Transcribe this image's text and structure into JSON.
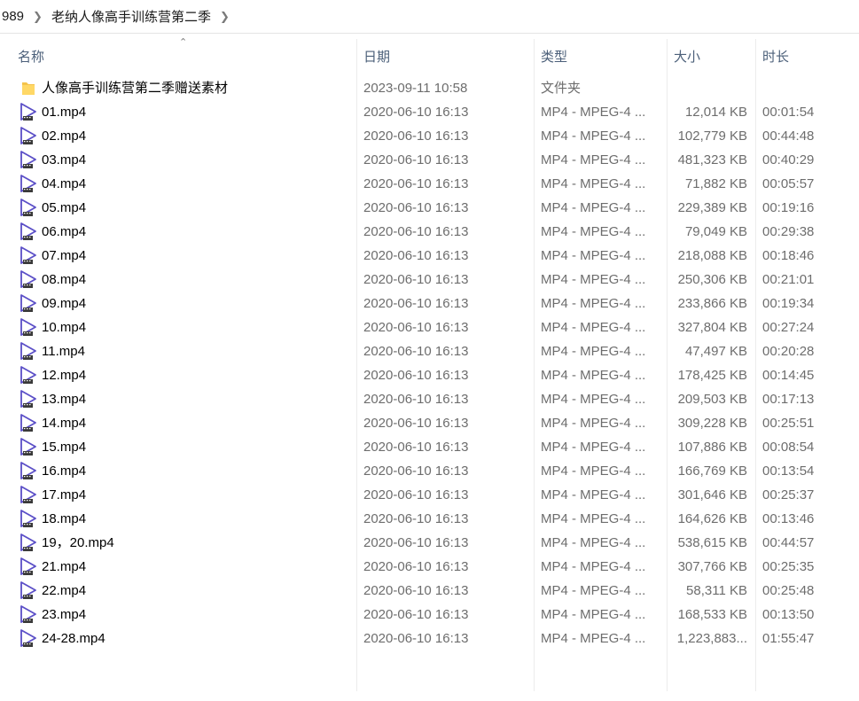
{
  "breadcrumb": {
    "items": [
      "989",
      "老纳人像高手训练营第二季"
    ]
  },
  "columns": {
    "name": "名称",
    "date": "日期",
    "type": "类型",
    "size": "大小",
    "duration": "时长"
  },
  "colors": {
    "video_icon": "#5b4fc7",
    "folder_icon": "#f5c34a",
    "header_text": "#4c607a"
  },
  "rows": [
    {
      "name": "人像高手训练营第二季赠送素材",
      "date": "2023-09-11 10:58",
      "type": "文件夹",
      "size": "",
      "duration": "",
      "icon": "folder-icon"
    },
    {
      "name": "01.mp4",
      "date": "2020-06-10 16:13",
      "type": "MP4 - MPEG-4 ...",
      "size": "12,014 KB",
      "duration": "00:01:54",
      "icon": "video-file-icon"
    },
    {
      "name": "02.mp4",
      "date": "2020-06-10 16:13",
      "type": "MP4 - MPEG-4 ...",
      "size": "102,779 KB",
      "duration": "00:44:48",
      "icon": "video-file-icon"
    },
    {
      "name": "03.mp4",
      "date": "2020-06-10 16:13",
      "type": "MP4 - MPEG-4 ...",
      "size": "481,323 KB",
      "duration": "00:40:29",
      "icon": "video-file-icon"
    },
    {
      "name": "04.mp4",
      "date": "2020-06-10 16:13",
      "type": "MP4 - MPEG-4 ...",
      "size": "71,882 KB",
      "duration": "00:05:57",
      "icon": "video-file-icon"
    },
    {
      "name": "05.mp4",
      "date": "2020-06-10 16:13",
      "type": "MP4 - MPEG-4 ...",
      "size": "229,389 KB",
      "duration": "00:19:16",
      "icon": "video-file-icon"
    },
    {
      "name": "06.mp4",
      "date": "2020-06-10 16:13",
      "type": "MP4 - MPEG-4 ...",
      "size": "79,049 KB",
      "duration": "00:29:38",
      "icon": "video-file-icon"
    },
    {
      "name": "07.mp4",
      "date": "2020-06-10 16:13",
      "type": "MP4 - MPEG-4 ...",
      "size": "218,088 KB",
      "duration": "00:18:46",
      "icon": "video-file-icon"
    },
    {
      "name": "08.mp4",
      "date": "2020-06-10 16:13",
      "type": "MP4 - MPEG-4 ...",
      "size": "250,306 KB",
      "duration": "00:21:01",
      "icon": "video-file-icon"
    },
    {
      "name": "09.mp4",
      "date": "2020-06-10 16:13",
      "type": "MP4 - MPEG-4 ...",
      "size": "233,866 KB",
      "duration": "00:19:34",
      "icon": "video-file-icon"
    },
    {
      "name": "10.mp4",
      "date": "2020-06-10 16:13",
      "type": "MP4 - MPEG-4 ...",
      "size": "327,804 KB",
      "duration": "00:27:24",
      "icon": "video-file-icon"
    },
    {
      "name": "11.mp4",
      "date": "2020-06-10 16:13",
      "type": "MP4 - MPEG-4 ...",
      "size": "47,497 KB",
      "duration": "00:20:28",
      "icon": "video-file-icon"
    },
    {
      "name": "12.mp4",
      "date": "2020-06-10 16:13",
      "type": "MP4 - MPEG-4 ...",
      "size": "178,425 KB",
      "duration": "00:14:45",
      "icon": "video-file-icon"
    },
    {
      "name": "13.mp4",
      "date": "2020-06-10 16:13",
      "type": "MP4 - MPEG-4 ...",
      "size": "209,503 KB",
      "duration": "00:17:13",
      "icon": "video-file-icon"
    },
    {
      "name": "14.mp4",
      "date": "2020-06-10 16:13",
      "type": "MP4 - MPEG-4 ...",
      "size": "309,228 KB",
      "duration": "00:25:51",
      "icon": "video-file-icon"
    },
    {
      "name": "15.mp4",
      "date": "2020-06-10 16:13",
      "type": "MP4 - MPEG-4 ...",
      "size": "107,886 KB",
      "duration": "00:08:54",
      "icon": "video-file-icon"
    },
    {
      "name": "16.mp4",
      "date": "2020-06-10 16:13",
      "type": "MP4 - MPEG-4 ...",
      "size": "166,769 KB",
      "duration": "00:13:54",
      "icon": "video-file-icon"
    },
    {
      "name": "17.mp4",
      "date": "2020-06-10 16:13",
      "type": "MP4 - MPEG-4 ...",
      "size": "301,646 KB",
      "duration": "00:25:37",
      "icon": "video-file-icon"
    },
    {
      "name": "18.mp4",
      "date": "2020-06-10 16:13",
      "type": "MP4 - MPEG-4 ...",
      "size": "164,626 KB",
      "duration": "00:13:46",
      "icon": "video-file-icon"
    },
    {
      "name": "19，20.mp4",
      "date": "2020-06-10 16:13",
      "type": "MP4 - MPEG-4 ...",
      "size": "538,615 KB",
      "duration": "00:44:57",
      "icon": "video-file-icon"
    },
    {
      "name": "21.mp4",
      "date": "2020-06-10 16:13",
      "type": "MP4 - MPEG-4 ...",
      "size": "307,766 KB",
      "duration": "00:25:35",
      "icon": "video-file-icon"
    },
    {
      "name": "22.mp4",
      "date": "2020-06-10 16:13",
      "type": "MP4 - MPEG-4 ...",
      "size": "58,311 KB",
      "duration": "00:25:48",
      "icon": "video-file-icon"
    },
    {
      "name": "23.mp4",
      "date": "2020-06-10 16:13",
      "type": "MP4 - MPEG-4 ...",
      "size": "168,533 KB",
      "duration": "00:13:50",
      "icon": "video-file-icon"
    },
    {
      "name": "24-28.mp4",
      "date": "2020-06-10 16:13",
      "type": "MP4 - MPEG-4 ...",
      "size": "1,223,883...",
      "duration": "01:55:47",
      "icon": "video-file-icon"
    }
  ]
}
